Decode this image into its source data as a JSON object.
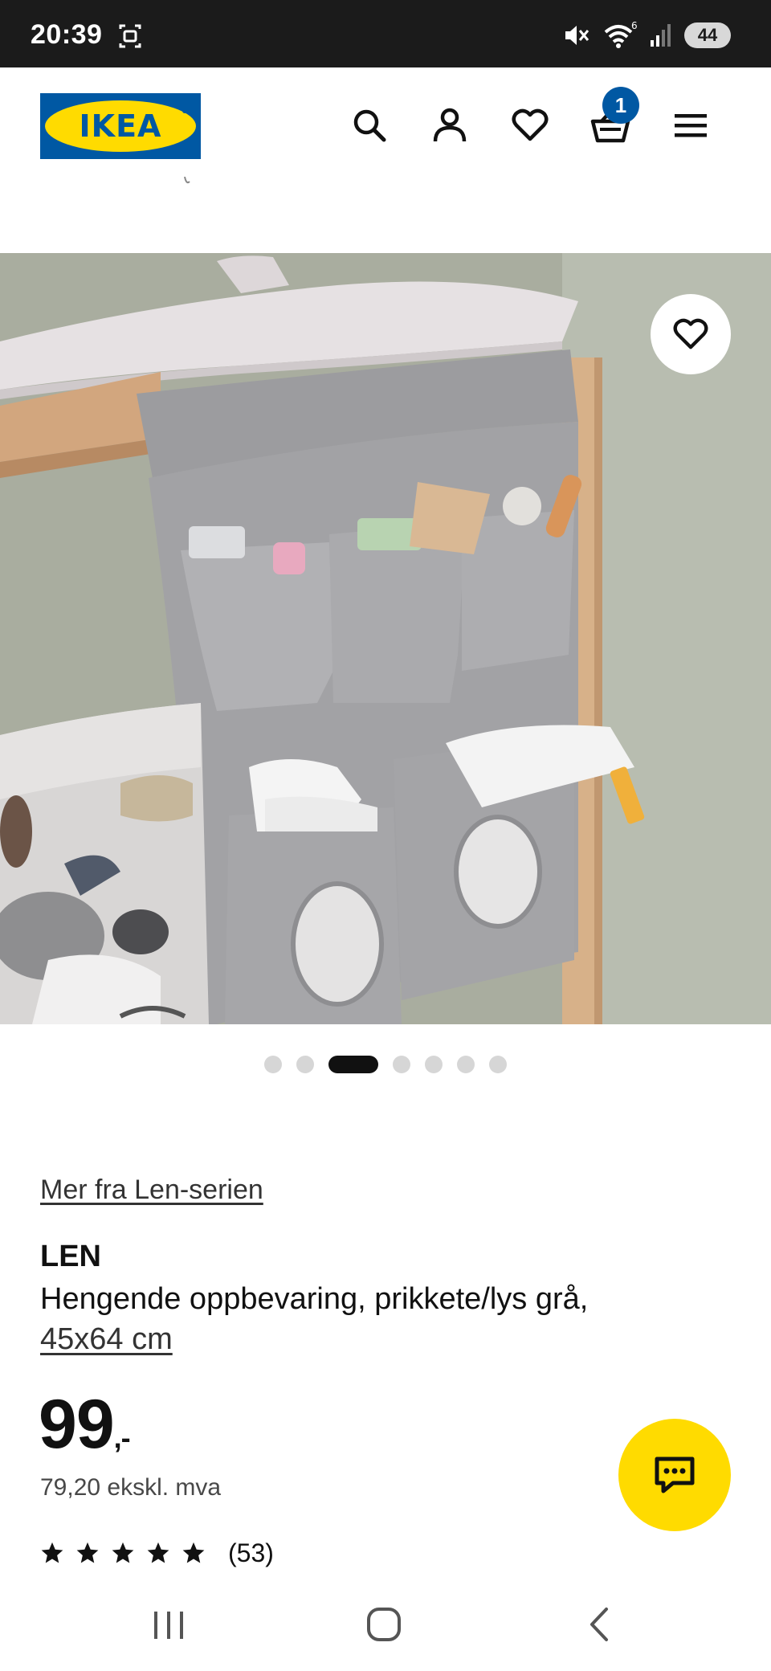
{
  "status": {
    "time": "20:39",
    "battery": "44",
    "wifi_label": "6"
  },
  "header": {
    "logo_text": "IKEA",
    "cart_count": "1",
    "brand_blue": "#0058a3",
    "brand_yellow": "#ffdb00"
  },
  "gallery": {
    "total_images": 7,
    "active_index": 2
  },
  "product": {
    "series_link": "Mer fra Len-serien",
    "name": "LEN",
    "description": "Hengende oppbevaring, prikkete/lys grå,",
    "size": "45x64 cm",
    "price_main": "99",
    "price_suffix": ",-",
    "price_ex_vat": "79,20 ekskl. mva",
    "rating_stars": 5,
    "rating_count": "(53)"
  },
  "icons": {
    "header": [
      "search-icon",
      "account-icon",
      "heart-icon",
      "cart-icon",
      "menu-icon"
    ],
    "image": [
      "favorite-icon"
    ],
    "chat": "chat-icon",
    "navigation": [
      "recent-apps-icon",
      "home-icon",
      "back-icon"
    ]
  }
}
